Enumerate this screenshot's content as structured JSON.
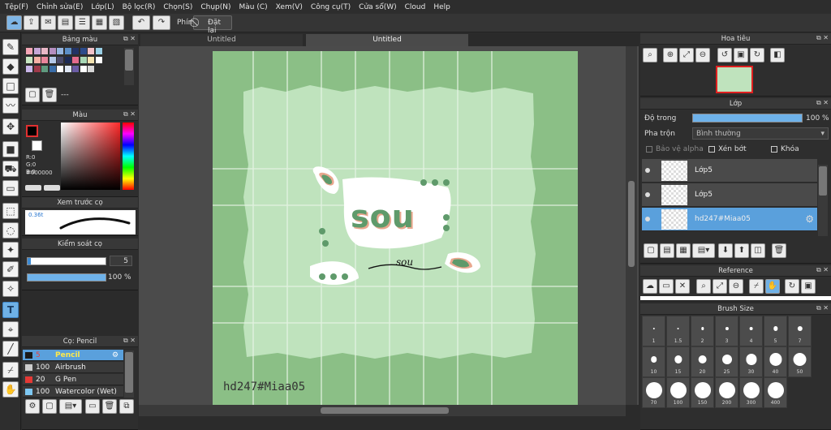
{
  "menu": [
    "Tệp(F)",
    "Chỉnh sửa(E)",
    "Lớp(L)",
    "Bộ lọc(R)",
    "Chọn(S)",
    "Chụp(N)",
    "Màu (C)",
    "Xem(V)",
    "Công cụ(T)",
    "Cửa sổ(W)",
    "Cloud",
    "Help"
  ],
  "toolbar": {
    "phim_label": "Phím",
    "reset_label": "Đặt lại"
  },
  "tabs": [
    "Untitled",
    "Untitled"
  ],
  "palette": {
    "title": "Bảng màu",
    "footer": "---",
    "colors": [
      "#f4a6b6",
      "#c6a6d7",
      "#e9b7c7",
      "#b58fc0",
      "#96b6e0",
      "#5c8fc8",
      "#223366",
      "#2b4a8a",
      "#f2c2c9",
      "#9ad0e6",
      "#c7e6c2",
      "#f5b0a5",
      "#e9859b",
      "#b5c9e8",
      "#4a4a6a",
      "#1c2a55",
      "#e36b8d",
      "#a7d7b5",
      "#f4e4b1",
      "#ffffff",
      "#c9b6e9",
      "#9f3a4a",
      "#5f9a7e",
      "#3a6da8",
      "#ffffff",
      "#dfe7f4",
      "#6b5ca5",
      "#ffffff",
      "#d9d9d9"
    ]
  },
  "color": {
    "title": "Màu",
    "r": "R:0",
    "g": "G:0",
    "b": "B:0",
    "hex": "#000000",
    "accent": "#000000"
  },
  "preview": {
    "title": "Xem trước cọ",
    "size": "0.36t"
  },
  "brush_control": {
    "title": "Kiểm soát cọ",
    "size": "5",
    "opacity": "100 %",
    "opacity_pct": 100
  },
  "brush_list": {
    "title": "Cọ: Pencil",
    "items": [
      {
        "size": "5",
        "name": "Pencil",
        "color": "#1a1a1a",
        "selected": true
      },
      {
        "size": "100",
        "name": "Airbrush",
        "color": "#cccccc",
        "selected": false
      },
      {
        "size": "20",
        "name": "G Pen",
        "color": "#e53935",
        "selected": false
      },
      {
        "size": "100",
        "name": "Watercolor (Wet)",
        "color": "#7ec8f2",
        "selected": false
      }
    ]
  },
  "navigator": {
    "title": "Hoa tiêu"
  },
  "layer": {
    "title": "Lớp",
    "opacity_label": "Độ trong",
    "opacity_value": "100 %",
    "opacity_pct": 100,
    "blend_label": "Pha trộn",
    "blend_value": "Bình thường",
    "protect_alpha": "Bảo vệ alpha",
    "clipping": "Xén bớt",
    "lock": "Khóa",
    "layers": [
      {
        "name": "Lớp5",
        "selected": false
      },
      {
        "name": "Lớp5",
        "selected": false
      },
      {
        "name": "hd247#Miaa05",
        "selected": true
      }
    ]
  },
  "reference": {
    "title": "Reference"
  },
  "brush_size": {
    "title": "Brush Size",
    "sizes": [
      "1",
      "1.5",
      "2",
      "3",
      "4",
      "5",
      "7",
      "10",
      "15",
      "20",
      "25",
      "30",
      "40",
      "50",
      "70",
      "100",
      "150",
      "200",
      "300",
      "400"
    ]
  },
  "artwork": {
    "title_text": "sou",
    "small_text": "sou",
    "watermark": "hd247#Miaa05"
  }
}
